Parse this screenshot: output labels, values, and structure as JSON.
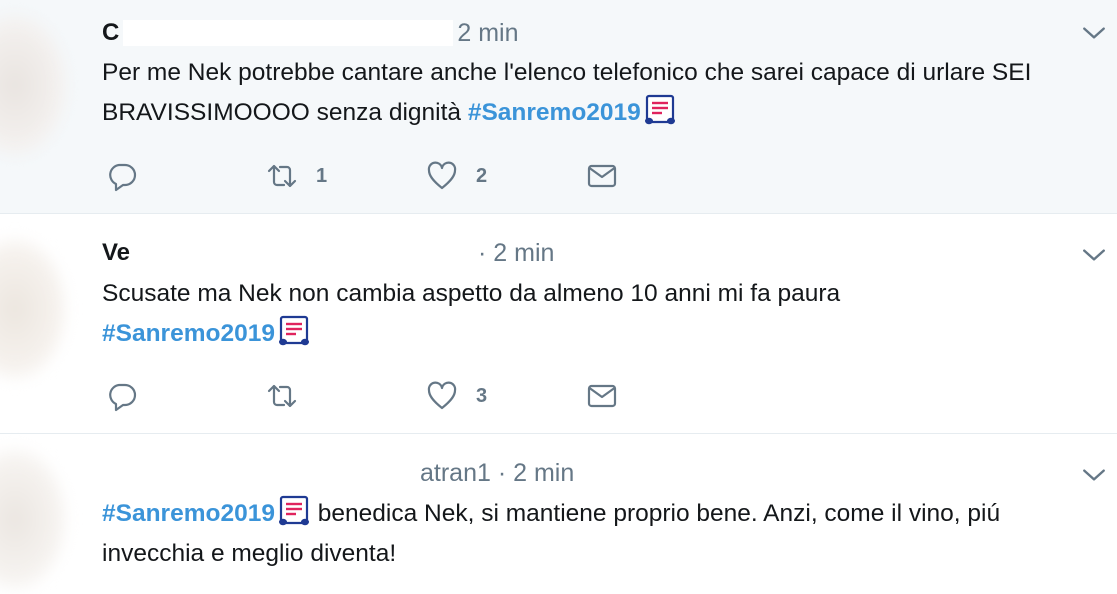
{
  "tweets": [
    {
      "name": "C",
      "handle_fragment": "",
      "time": "2 min",
      "text_before": "Per me Nek potrebbe cantare anche l'elenco telefonico che sarei capace di urlare SEI BRAVISSIMOOOO senza dignità ",
      "hashtag": "#Sanremo2019",
      "text_after": "",
      "reply_count": "",
      "retweet_count": "1",
      "like_count": "2"
    },
    {
      "name": "Ve",
      "handle_fragment": "",
      "time": "· 2 min",
      "text_before": "Scusate ma Nek non cambia aspetto da almeno 10 anni mi fa paura ",
      "hashtag": "#Sanremo2019",
      "text_after": "",
      "reply_count": "",
      "retweet_count": "",
      "like_count": "3"
    },
    {
      "name": "",
      "handle_fragment": "atran1",
      "time": "· 2 min",
      "text_before": "",
      "hashtag": "#Sanremo2019",
      "text_after": " benedica Nek, si mantiene proprio bene. Anzi, come il vino, piú invecchia e meglio diventa!"
    }
  ],
  "icons": {
    "reply": "reply-icon",
    "retweet": "retweet-icon",
    "like": "heart-icon",
    "dm": "envelope-icon",
    "caret": "chevron-down-icon",
    "emoji": "musical-score-emoji"
  },
  "colors": {
    "hashtag": "#3b94d9",
    "meta": "#657786",
    "text": "#14171a",
    "highlight_bg": "#f5f8fa"
  }
}
